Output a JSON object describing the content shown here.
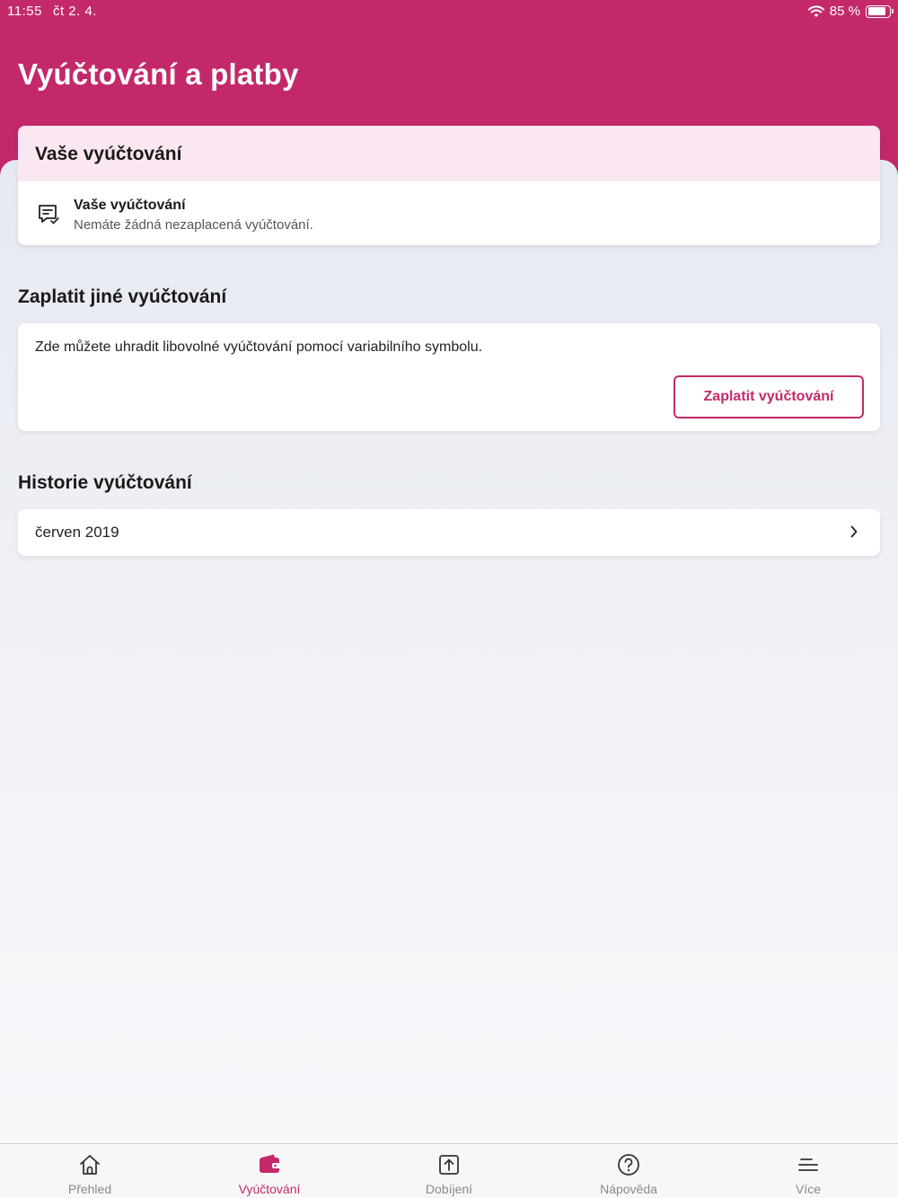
{
  "status_bar": {
    "time": "11:55",
    "date": "čt 2. 4.",
    "battery_text": "85 %",
    "battery_level": 0.85
  },
  "header": {
    "title": "Vyúčtování a platby"
  },
  "your_billing": {
    "section_title": "Vaše vyúčtování",
    "row_title": "Vaše vyúčtování",
    "row_subtitle": "Nemáte žádná nezaplacená vyúčtování.",
    "icon": "bill-icon"
  },
  "pay_other": {
    "section_title": "Zaplatit jiné vyúčtování",
    "description": "Zde můžete uhradit libovolné vyúčtování pomocí variabilního symbolu.",
    "button_label": "Zaplatit vyúčtování"
  },
  "history": {
    "section_title": "Historie vyúčtování",
    "items": [
      {
        "label": "červen 2019"
      }
    ]
  },
  "tabbar": {
    "items": [
      {
        "label": "Přehled",
        "icon": "home-icon",
        "active": false
      },
      {
        "label": "Vyúčtování",
        "icon": "wallet-icon",
        "active": true
      },
      {
        "label": "Dobíjení",
        "icon": "topup-icon",
        "active": false
      },
      {
        "label": "Nápověda",
        "icon": "help-icon",
        "active": false
      },
      {
        "label": "Více",
        "icon": "menu-icon",
        "active": false
      }
    ]
  },
  "colors": {
    "brand": "#c42a6a",
    "highlight_bg": "#fbe7f1"
  }
}
